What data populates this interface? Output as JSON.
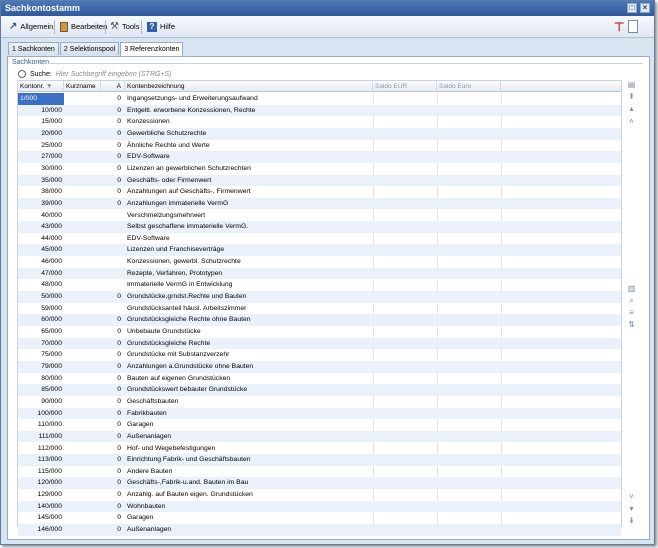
{
  "window": {
    "title": "Sachkontostamm"
  },
  "menu": {
    "items": [
      {
        "label": "Allgemein",
        "icon": "arrow-icon"
      },
      {
        "label": "Bearbeiten",
        "icon": "clipboard-icon"
      },
      {
        "label": "Tools",
        "icon": "tools-icon"
      },
      {
        "label": "Hilfe",
        "icon": "help-icon"
      }
    ]
  },
  "tabs": [
    "1 Sachkonten",
    "2 Selektionspool",
    "3 Referenzkonten"
  ],
  "active_tab": "3 Referenzkonten",
  "group": {
    "title": "Sachkonten"
  },
  "search": {
    "label": "Suche:",
    "placeholder": "Hier Suchbegriff eingeben (STRG+S)"
  },
  "columns": [
    "Kontonr.",
    "Kurzname",
    "A",
    "Kontenbezeichnung",
    "Saldo EUR",
    "Saldo Euro"
  ],
  "rows": [
    {
      "kto": "1/000",
      "a": "0",
      "bez": "Ingangsetzungs- und Erweiterungsaufwand"
    },
    {
      "kto": "10/000",
      "a": "0",
      "bez": "Entgeltl. erworbene Konzessionen, Rechte"
    },
    {
      "kto": "15/000",
      "a": "0",
      "bez": "Konzessionen"
    },
    {
      "kto": "20/000",
      "a": "0",
      "bez": "Gewerbliche Schutzrechte"
    },
    {
      "kto": "25/000",
      "a": "0",
      "bez": "Ähnliche Rechte und Werte"
    },
    {
      "kto": "27/000",
      "a": "0",
      "bez": "EDV-Software"
    },
    {
      "kto": "30/000",
      "a": "0",
      "bez": "Lizenzen an gewerblichen Schutzrechten"
    },
    {
      "kto": "35/000",
      "a": "0",
      "bez": "Geschäfts- oder Firmenwert"
    },
    {
      "kto": "38/000",
      "a": "0",
      "bez": "Anzahlungen auf Geschäfts-, Firmenwert"
    },
    {
      "kto": "39/000",
      "a": "0",
      "bez": "Anzahlungen immaterielle VermG"
    },
    {
      "kto": "40/000",
      "a": "",
      "bez": "Verschmelzungsmehrwert"
    },
    {
      "kto": "43/000",
      "a": "",
      "bez": "Selbst geschaffene immaterielle VermG."
    },
    {
      "kto": "44/000",
      "a": "",
      "bez": "EDV-Software"
    },
    {
      "kto": "45/000",
      "a": "",
      "bez": "Lizenzen und Franchiseverträge"
    },
    {
      "kto": "46/000",
      "a": "",
      "bez": "Konzessionen, gewerbl. Schutzrechte"
    },
    {
      "kto": "47/000",
      "a": "",
      "bez": "Rezepte, Verfahren, Prototypen"
    },
    {
      "kto": "48/000",
      "a": "",
      "bez": "Immaterielle VermG in Entwicklung"
    },
    {
      "kto": "50/000",
      "a": "0",
      "bez": "Grundstücke,grndst.Rechte und Bauten"
    },
    {
      "kto": "59/000",
      "a": "",
      "bez": "Grundstücksanteil häusl. Arbeitszimmer"
    },
    {
      "kto": "60/000",
      "a": "0",
      "bez": "Grundstücksgleiche Rechte ohne Bauten"
    },
    {
      "kto": "65/000",
      "a": "0",
      "bez": "Unbebaute Grundstücke"
    },
    {
      "kto": "70/000",
      "a": "0",
      "bez": "Grundstücksgleiche Rechte"
    },
    {
      "kto": "75/000",
      "a": "0",
      "bez": "Grundstücke mit Substanzverzehr"
    },
    {
      "kto": "79/000",
      "a": "0",
      "bez": "Anzahlungen a.Grundstücke ohne Bauten"
    },
    {
      "kto": "80/000",
      "a": "0",
      "bez": "Bauten auf eigenen Grundstücken"
    },
    {
      "kto": "85/000",
      "a": "0",
      "bez": "Grundstückswert bebauter Grundstücke"
    },
    {
      "kto": "90/000",
      "a": "0",
      "bez": "Geschäftsbauten"
    },
    {
      "kto": "100/000",
      "a": "0",
      "bez": "Fabrikbauten"
    },
    {
      "kto": "110/000",
      "a": "0",
      "bez": "Garagen"
    },
    {
      "kto": "111/000",
      "a": "0",
      "bez": "Außenanlagen"
    },
    {
      "kto": "112/000",
      "a": "0",
      "bez": "Hof- und Wegebefestigungen"
    },
    {
      "kto": "113/000",
      "a": "0",
      "bez": "Einrichtung Fabrik- und Geschäftsbauten"
    },
    {
      "kto": "115/000",
      "a": "0",
      "bez": "Andere Bauten"
    },
    {
      "kto": "120/000",
      "a": "0",
      "bez": "Geschäfts-,Fabrik-u.and. Bauten im Bau"
    },
    {
      "kto": "129/000",
      "a": "0",
      "bez": "Anzahlg. auf Bauten eigen. Grundstücken"
    },
    {
      "kto": "140/000",
      "a": "0",
      "bez": "Wohnbauten"
    },
    {
      "kto": "145/000",
      "a": "0",
      "bez": "Garagen"
    },
    {
      "kto": "146/000",
      "a": "0",
      "bez": "Außenanlagen"
    }
  ]
}
